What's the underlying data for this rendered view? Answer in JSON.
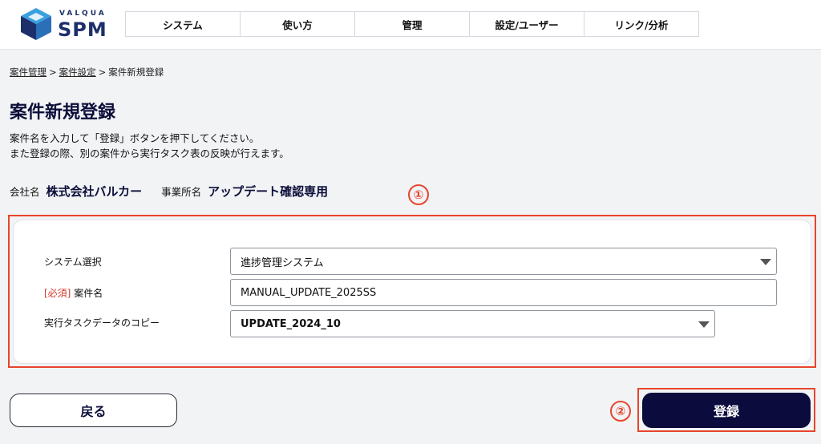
{
  "brand": {
    "top": "VALQUA",
    "name": "SPM"
  },
  "nav": {
    "items": [
      "システム",
      "使い方",
      "管理",
      "設定/ユーザー",
      "リンク/分析"
    ]
  },
  "breadcrumb": {
    "items": [
      "案件管理",
      "案件設定",
      "案件新規登録"
    ],
    "separator": ">"
  },
  "page": {
    "title": "案件新規登録",
    "desc_line1": "案件名を入力して「登録」ボタンを押下してください。",
    "desc_line2": "また登録の際、別の案件から実行タスク表の反映が行えます。"
  },
  "company": {
    "company_label": "会社名",
    "company_value": "株式会社バルカー",
    "office_label": "事業所名",
    "office_value": "アップデート確認専用"
  },
  "form": {
    "system_label": "システム選択",
    "system_value": "進捗管理システム",
    "required_tag": "[必須]",
    "name_label": "案件名",
    "name_value": "MANUAL_UPDATE_2025SS",
    "copy_label": "実行タスクデータのコピー",
    "copy_value": "UPDATE_2024_10"
  },
  "buttons": {
    "back": "戻る",
    "register": "登録"
  },
  "annotations": {
    "marker1": "①",
    "marker2": "②",
    "color": "#e8452c"
  },
  "colors": {
    "navy": "#0b0b3d",
    "brand_blue": "#1c2f6b",
    "required_red": "#d23a2a"
  }
}
